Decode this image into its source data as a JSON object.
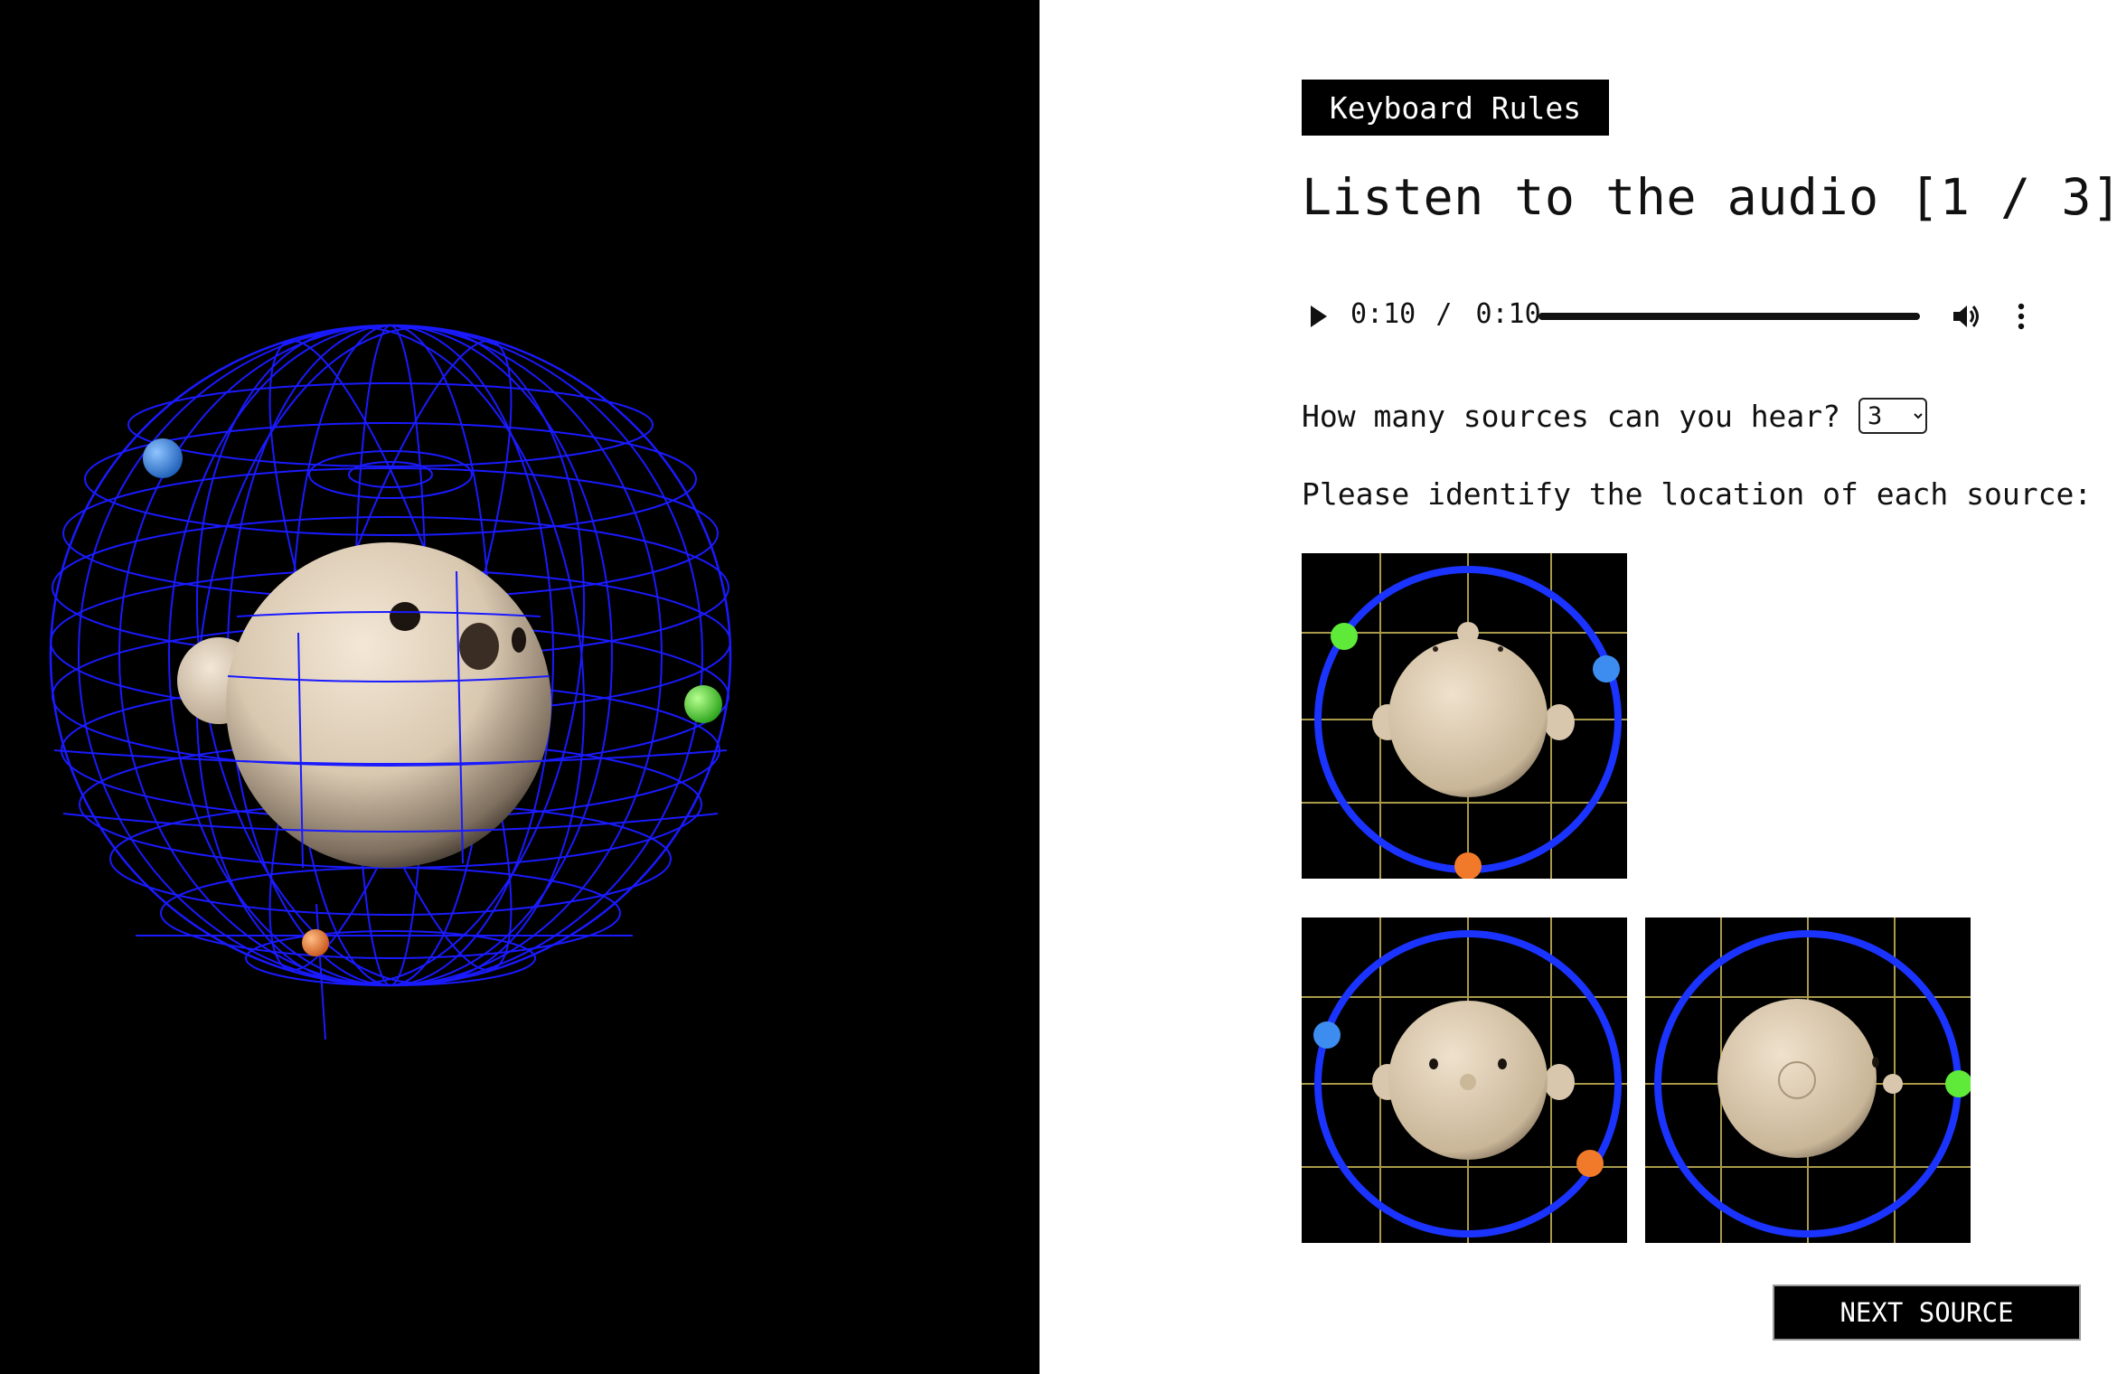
{
  "header": {
    "rules_label": "Keyboard Rules"
  },
  "audio_title": "Listen to the audio [1 / 3]",
  "player": {
    "current_time": "0:10",
    "separator": "/",
    "duration": "0:10",
    "progress": 1.0,
    "icons": {
      "play": "play-icon",
      "volume": "volume-icon",
      "more": "more-options-icon"
    }
  },
  "sources": {
    "question": "How many sources can you hear?",
    "selected": "3"
  },
  "identify_prompt": "Please identify the location of each source:",
  "source_colors": {
    "blue": "#3d8df0",
    "green": "#5fea3a",
    "orange": "#f07a2a"
  },
  "colors": {
    "ring": "#1a33ff",
    "grid": "#a89a4a",
    "wireframe": "#1a1aff",
    "head": "#e2d3bd"
  },
  "views": [
    "top-view",
    "front-view",
    "side-view"
  ],
  "next_label": "NEXT SOURCE"
}
